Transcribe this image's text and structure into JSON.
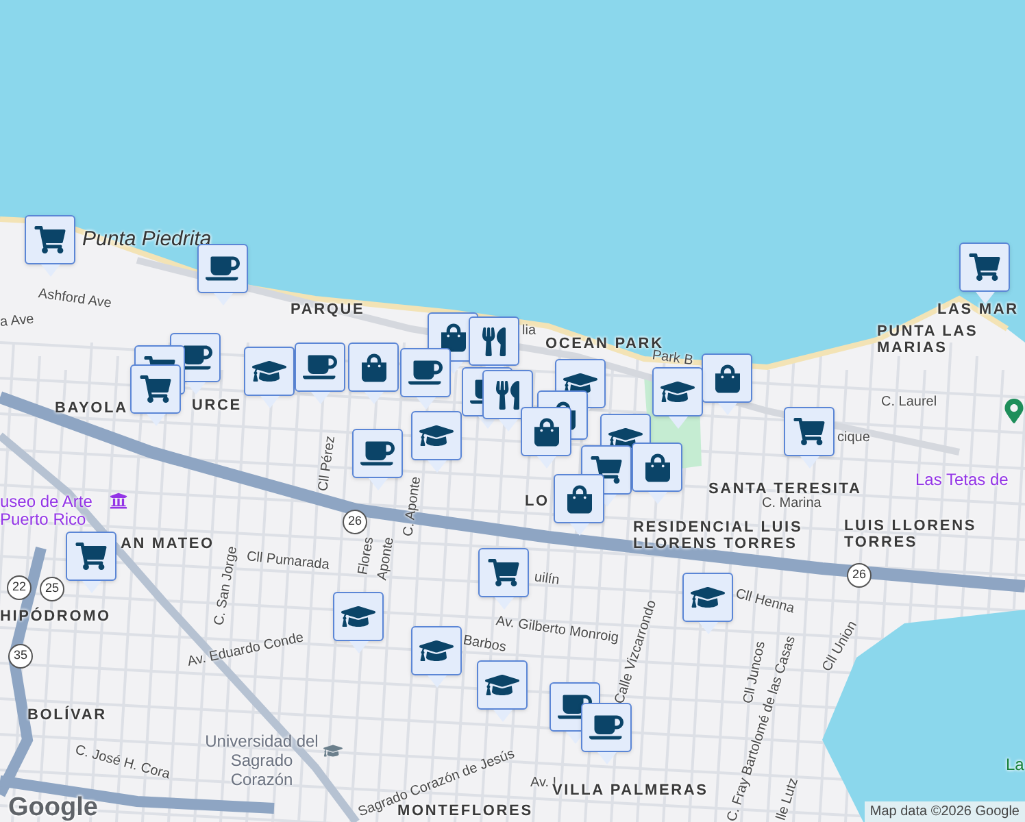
{
  "map": {
    "labels": [
      {
        "text": "Punta Piedrita",
        "kind": "place"
      },
      {
        "text": "Ashford Ave",
        "kind": "street"
      },
      {
        "text": "a Ave",
        "kind": "street"
      },
      {
        "text": "PARQUE",
        "kind": "district"
      },
      {
        "text": "lia",
        "kind": "street"
      },
      {
        "text": "OCEAN PARK",
        "kind": "district"
      },
      {
        "text": "Park B",
        "kind": "street"
      },
      {
        "text": "BAYOLA",
        "kind": "district"
      },
      {
        "text": "URCE",
        "kind": "district"
      },
      {
        "text": "C. Laurel",
        "kind": "street"
      },
      {
        "text": "cique",
        "kind": "street"
      },
      {
        "text": "LAS MAR",
        "kind": "district"
      },
      {
        "text": "PUNTA LAS MARIAS",
        "kind": "district"
      },
      {
        "text": "Las Tetas de",
        "kind": "poi"
      },
      {
        "text": "SANTA TERESITA",
        "kind": "district"
      },
      {
        "text": "C. Marina",
        "kind": "street"
      },
      {
        "text": "LUIS LLORENS TORRES",
        "kind": "district"
      },
      {
        "text": "LO",
        "kind": "district"
      },
      {
        "text": "RESIDENCIAL LUIS LLORENS TORRES",
        "kind": "district"
      },
      {
        "text": "useo de Arte Puerto Rico",
        "kind": "poi"
      },
      {
        "text": "AN MATEO",
        "kind": "district"
      },
      {
        "text": "C. San Jorge",
        "kind": "street"
      },
      {
        "text": "Cll Pumarada",
        "kind": "street"
      },
      {
        "text": "Cll Pérez",
        "kind": "street"
      },
      {
        "text": "C. Aponte",
        "kind": "street"
      },
      {
        "text": "Flores",
        "kind": "street"
      },
      {
        "text": "Aponte",
        "kind": "street"
      },
      {
        "text": "HIPÓDROMO",
        "kind": "district"
      },
      {
        "text": "Av. Eduardo Conde",
        "kind": "street"
      },
      {
        "text": "Barbos",
        "kind": "street"
      },
      {
        "text": "Av. Gilberto Monroig",
        "kind": "street"
      },
      {
        "text": "uilín",
        "kind": "street"
      },
      {
        "text": "Cll Henna",
        "kind": "street"
      },
      {
        "text": "Calle Vizcarrondo",
        "kind": "street"
      },
      {
        "text": "Cll Juncos",
        "kind": "street"
      },
      {
        "text": "C. Fray Bartolomé de las Casas",
        "kind": "street"
      },
      {
        "text": "Cll Union",
        "kind": "street"
      },
      {
        "text": "BOLÍVAR",
        "kind": "district"
      },
      {
        "text": "Universidad del Sagrado Corazón",
        "kind": "campus"
      },
      {
        "text": "C. José H. Cora",
        "kind": "street"
      },
      {
        "text": "Sagrado Corazón de Jesús",
        "kind": "street"
      },
      {
        "text": "Av. I",
        "kind": "street"
      },
      {
        "text": "VILLA PALMERAS",
        "kind": "district"
      },
      {
        "text": "MONTEFLORES",
        "kind": "district"
      },
      {
        "text": "lle Lutz",
        "kind": "street"
      },
      {
        "text": "La",
        "kind": "park"
      }
    ],
    "route_shields": [
      {
        "text": "26"
      },
      {
        "text": "26"
      },
      {
        "text": "22"
      },
      {
        "text": "25"
      },
      {
        "text": "35"
      }
    ],
    "markers": [
      {
        "kind": "cart"
      },
      {
        "kind": "cafe"
      },
      {
        "kind": "cart"
      },
      {
        "kind": "bag"
      },
      {
        "kind": "food"
      },
      {
        "kind": "cafe"
      },
      {
        "kind": "cart"
      },
      {
        "kind": "cart"
      },
      {
        "kind": "school"
      },
      {
        "kind": "cafe"
      },
      {
        "kind": "bag"
      },
      {
        "kind": "cafe"
      },
      {
        "kind": "school"
      },
      {
        "kind": "cafe"
      },
      {
        "kind": "cafe"
      },
      {
        "kind": "food"
      },
      {
        "kind": "school"
      },
      {
        "kind": "bag"
      },
      {
        "kind": "bag"
      },
      {
        "kind": "bag"
      },
      {
        "kind": "school"
      },
      {
        "kind": "school"
      },
      {
        "kind": "cart"
      },
      {
        "kind": "bag"
      },
      {
        "kind": "bag"
      },
      {
        "kind": "cart"
      },
      {
        "kind": "cart"
      },
      {
        "kind": "cart"
      },
      {
        "kind": "school"
      },
      {
        "kind": "school"
      },
      {
        "kind": "school"
      },
      {
        "kind": "school"
      },
      {
        "kind": "cafe"
      },
      {
        "kind": "cafe"
      }
    ],
    "logo": "Google",
    "attribution": "Map data ©2026 Google"
  }
}
